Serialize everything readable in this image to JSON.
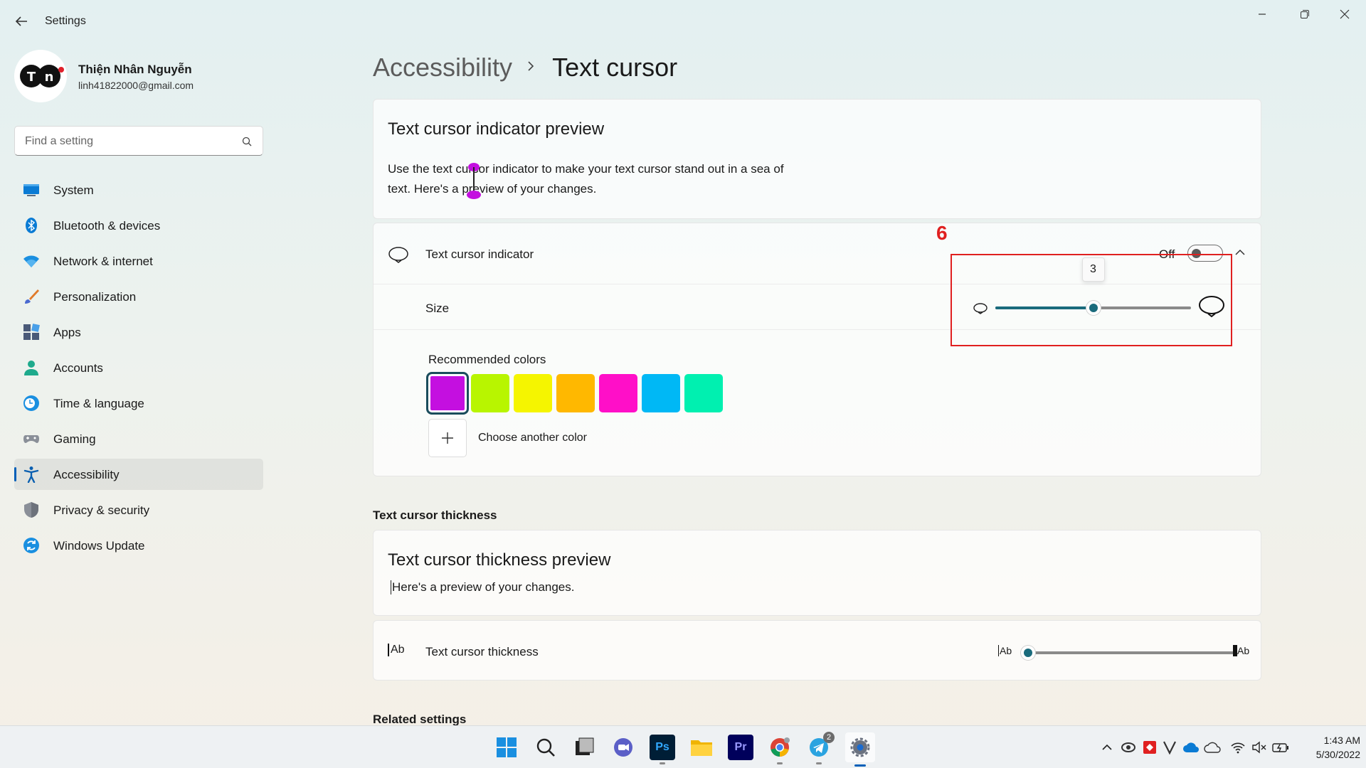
{
  "window": {
    "app_title": "Settings",
    "back_icon": "back-arrow-icon",
    "minimize_icon": "minimize-icon",
    "restore_icon": "restore-icon",
    "close_icon": "close-icon"
  },
  "profile": {
    "avatar_text": "TN",
    "name": "Thiện Nhân Nguyễn",
    "email": "linh41822000@gmail.com"
  },
  "search": {
    "placeholder": "Find a setting",
    "icon": "search-icon"
  },
  "sidebar": {
    "items": [
      {
        "label": "System",
        "icon": "monitor-icon",
        "color": "#0078d4"
      },
      {
        "label": "Bluetooth & devices",
        "icon": "bluetooth-icon",
        "color": "#0078d4"
      },
      {
        "label": "Network & internet",
        "icon": "wifi-icon",
        "color": "#1a8fe0"
      },
      {
        "label": "Personalization",
        "icon": "brush-icon",
        "color": "#e07a2a"
      },
      {
        "label": "Apps",
        "icon": "apps-icon",
        "color": "#4a5a78"
      },
      {
        "label": "Accounts",
        "icon": "person-icon",
        "color": "#1eaa8c"
      },
      {
        "label": "Time & language",
        "icon": "clock-globe-icon",
        "color": "#1a8fe0"
      },
      {
        "label": "Gaming",
        "icon": "gamepad-icon",
        "color": "#8a8f98"
      },
      {
        "label": "Accessibility",
        "icon": "accessibility-icon",
        "color": "#0a5fb0",
        "active": true
      },
      {
        "label": "Privacy & security",
        "icon": "shield-icon",
        "color": "#7a7f88"
      },
      {
        "label": "Windows Update",
        "icon": "update-icon",
        "color": "#1a8fe0"
      }
    ]
  },
  "breadcrumb": {
    "parent": "Accessibility",
    "current": "Text cursor"
  },
  "indicator_preview": {
    "title": "Text cursor indicator preview",
    "body": "Use the text cursor indicator to make your text cursor stand out in a sea of text. Here's a preview of your changes.",
    "indicator_color": "#c40fe0"
  },
  "indicator_setting": {
    "label": "Text cursor indicator",
    "icon": "cursor-indicator-icon",
    "toggle_state": "Off",
    "toggle_on": false,
    "expand_icon": "chevron-up-icon"
  },
  "size_setting": {
    "label": "Size",
    "value": "3",
    "slider_fraction": 0.5,
    "min_icon": "small-indicator-icon",
    "max_icon": "large-indicator-icon"
  },
  "colors": {
    "label": "Recommended colors",
    "swatches": [
      "#c40fe0",
      "#b8f500",
      "#f5f500",
      "#ffb800",
      "#ff0fc8",
      "#00b8f5",
      "#00f0b0"
    ],
    "selected_index": 0,
    "choose_label": "Choose another color",
    "add_icon": "plus-icon"
  },
  "annotation": {
    "step_number": "6",
    "color": "#e02020"
  },
  "thickness_section": {
    "heading": "Text cursor thickness"
  },
  "thickness_preview": {
    "title": "Text cursor thickness preview",
    "body": "Here's a preview of your changes."
  },
  "thickness_setting": {
    "label": "Text cursor thickness",
    "icon": "text-cursor-icon",
    "slider_fraction": 0.0,
    "min_label": "Ab",
    "max_label": "Ab"
  },
  "related": {
    "heading": "Related settings"
  },
  "taskbar": {
    "apps": [
      {
        "name": "start-icon"
      },
      {
        "name": "search-icon"
      },
      {
        "name": "task-view-icon"
      },
      {
        "name": "chat-icon"
      },
      {
        "name": "photoshop-icon",
        "label": "Ps",
        "running": true
      },
      {
        "name": "file-explorer-icon"
      },
      {
        "name": "premiere-icon",
        "label": "Pr"
      },
      {
        "name": "chrome-icon",
        "running": true
      },
      {
        "name": "telegram-icon",
        "badge": "2",
        "running": true
      },
      {
        "name": "settings-icon",
        "active": true
      }
    ],
    "tray": [
      "chevron-up-icon",
      "vpn-icon",
      "antivirus-icon",
      "vivaldi-icon",
      "onedrive-icon",
      "cloud-icon",
      "wifi-icon",
      "volume-mute-icon",
      "battery-icon"
    ],
    "time": "1:43 AM",
    "date": "5/30/2022"
  }
}
